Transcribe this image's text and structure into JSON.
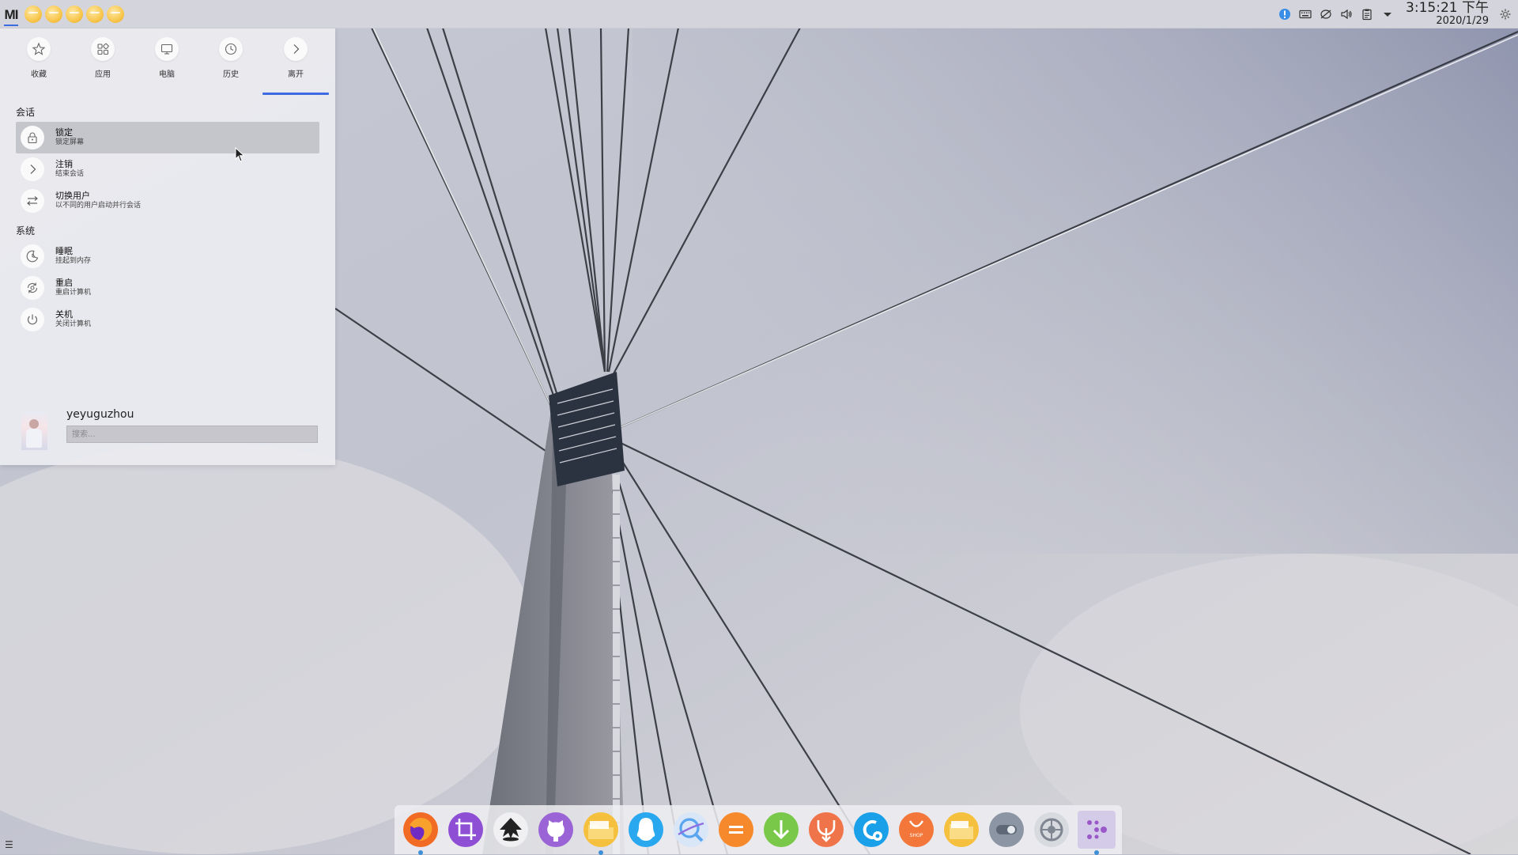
{
  "top_panel": {
    "logo_text": "MI",
    "folder_launchers": [
      "folder",
      "folder",
      "folder",
      "folder",
      "folder"
    ],
    "tray_icons": [
      "info-icon",
      "keyboard-icon",
      "network-icon",
      "volume-icon",
      "clipboard-icon",
      "expand-tray-icon"
    ],
    "clock": {
      "time": "3:15:21 下午",
      "date": "2020/1/29"
    }
  },
  "launcher": {
    "tabs": [
      {
        "label": "收藏",
        "icon": "star-icon"
      },
      {
        "label": "应用",
        "icon": "apps-icon"
      },
      {
        "label": "电脑",
        "icon": "computer-icon"
      },
      {
        "label": "历史",
        "icon": "history-icon"
      },
      {
        "label": "离开",
        "icon": "leave-icon"
      }
    ],
    "active_tab": "离开",
    "sections": [
      {
        "title": "会话",
        "items": [
          {
            "title": "锁定",
            "subtitle": "锁定屏幕",
            "icon": "lock-icon"
          },
          {
            "title": "注销",
            "subtitle": "结束会话",
            "icon": "logout-icon"
          },
          {
            "title": "切换用户",
            "subtitle": "以不同的用户启动并行会话",
            "icon": "switch-user-icon"
          }
        ]
      },
      {
        "title": "系统",
        "items": [
          {
            "title": "睡眠",
            "subtitle": "挂起到内存",
            "icon": "sleep-icon"
          },
          {
            "title": "重启",
            "subtitle": "重启计算机",
            "icon": "restart-icon"
          },
          {
            "title": "关机",
            "subtitle": "关闭计算机",
            "icon": "power-icon"
          }
        ]
      }
    ],
    "user": {
      "name": "yeyuguzhou"
    },
    "search_placeholder": "搜索..."
  },
  "dock": {
    "apps": [
      {
        "name": "firefox",
        "color": "#f26b24"
      },
      {
        "name": "screenshot-crop",
        "color": "#8e4fd4"
      },
      {
        "name": "inkscape",
        "color": "#222222"
      },
      {
        "name": "github",
        "color": "#9a63d6"
      },
      {
        "name": "files",
        "color": "#f6c03f"
      },
      {
        "name": "qq",
        "color": "#29a8f0"
      },
      {
        "name": "search-tool",
        "color": "#5aa5ef"
      },
      {
        "name": "calculator",
        "color": "#f5892b"
      },
      {
        "name": "downloader",
        "color": "#7ac84a"
      },
      {
        "name": "uget",
        "color": "#f0744a"
      },
      {
        "name": "tools",
        "color": "#1aa0e8"
      },
      {
        "name": "shop",
        "color": "#f3773a",
        "text": "SHOP"
      },
      {
        "name": "folder",
        "color": "#f6c03f"
      },
      {
        "name": "toggle",
        "color": "#8b95a3"
      },
      {
        "name": "settings",
        "color": "#7f8692"
      },
      {
        "name": "launcher-more",
        "color": "#9a58c9"
      }
    ],
    "running": [
      "firefox",
      "files",
      "launcher-more"
    ]
  }
}
